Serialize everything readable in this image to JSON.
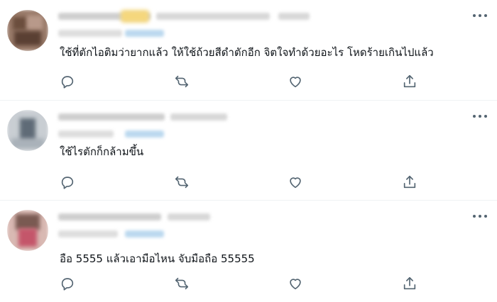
{
  "replies": [
    {
      "text": "ใช้ที่ตักไอติมว่ายากแล้ว ให้ใช้ถ้วยสีดำตักอีก  จิตใจทำด้วยอะไร โหดร้ายเกินไปแล้ว"
    },
    {
      "text": "ใช้ไรตักก็กล้ามขึ้น"
    },
    {
      "text": "อือ 5555 แล้วเอามือไหน จับมือถือ 55555"
    }
  ],
  "icons": {
    "reply": "reply-icon",
    "retweet": "retweet-icon",
    "like": "heart-icon",
    "share": "share-icon",
    "more": "more-icon"
  },
  "colors": {
    "icon": "#536471",
    "divider": "#eff3f4",
    "text": "#0f1419"
  }
}
